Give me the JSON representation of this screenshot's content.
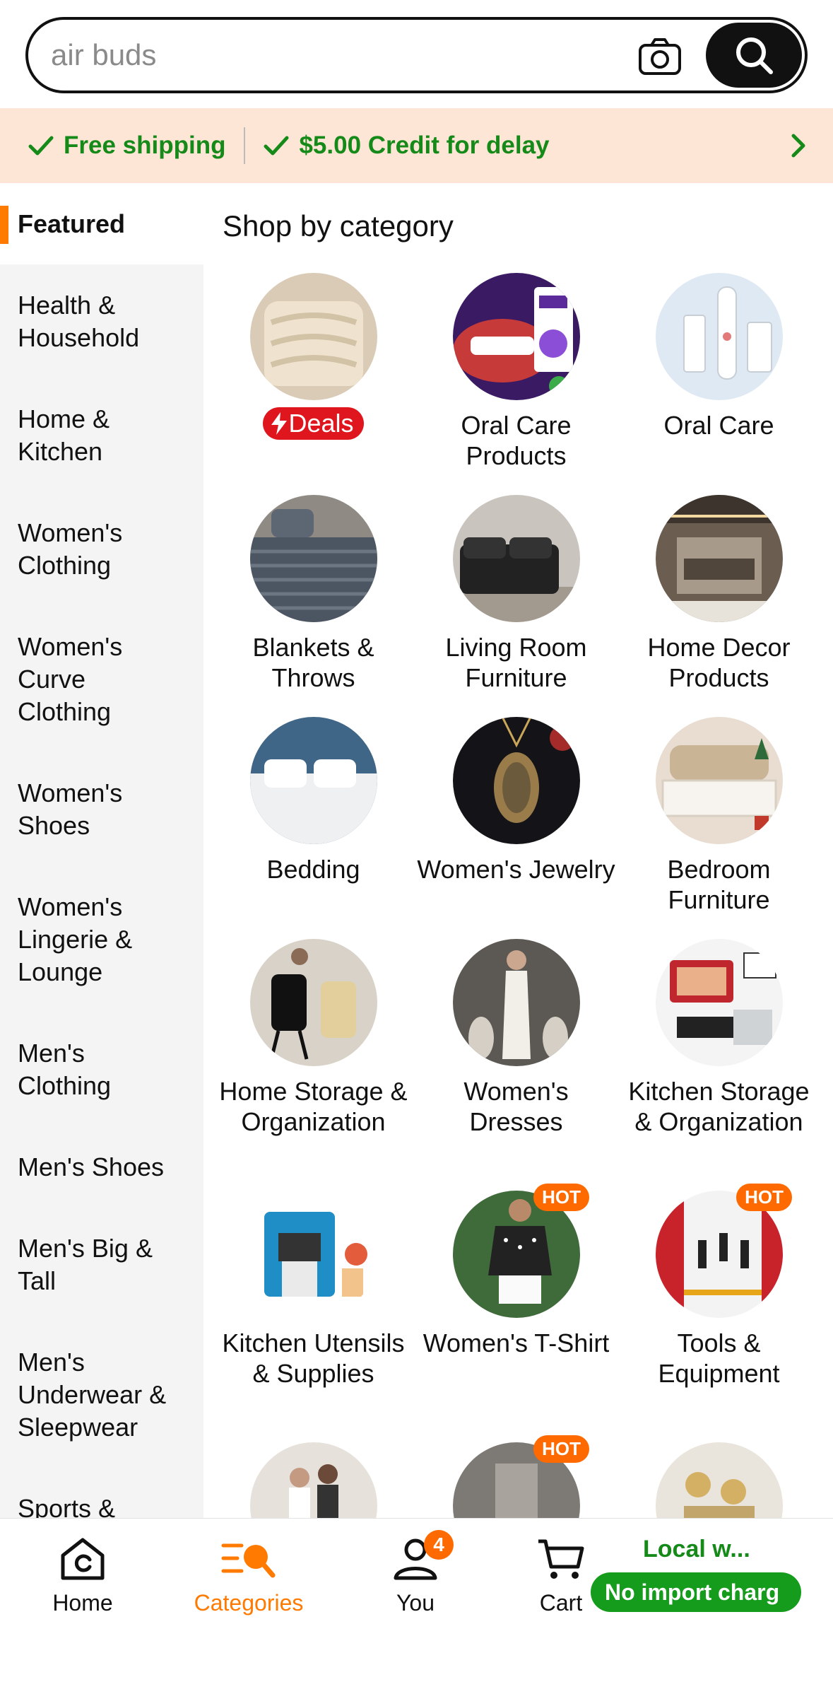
{
  "search": {
    "placeholder": "air buds"
  },
  "promo": {
    "item1": "Free shipping",
    "item2": "$5.00 Credit for delay"
  },
  "sidebar": {
    "items": [
      "Featured",
      "Health &\nHousehold",
      "Home &\nKitchen",
      "Women's\nClothing",
      "Women's\nCurve\nClothing",
      "Women's\nShoes",
      "Women's\nLingerie &\nLounge",
      "Men's\nClothing",
      "Men's Shoes",
      "Men's Big &\nTall",
      "Men's\nUnderwear &\nSleepwear",
      "Sports &"
    ]
  },
  "main": {
    "title": "Shop by category",
    "deals_label": "Deals",
    "hot_label": "HOT",
    "categories": [
      "",
      "Oral Care Products",
      "Oral Care",
      "Blankets & Throws",
      "Living Room Furniture",
      "Home Decor Products",
      "Bedding",
      "Women's Jewelry",
      "Bedroom Furniture",
      "Home Storage & Organization",
      "Women's Dresses",
      "Kitchen Storage & Organization",
      "Kitchen Utensils & Supplies",
      "Women's T-Shirt",
      "Tools & Equipment"
    ]
  },
  "nav": {
    "home": "Home",
    "categories": "Categories",
    "you": "You",
    "you_badge": "4",
    "cart": "Cart",
    "local": "Local w...",
    "import": "No import charg"
  },
  "colors": {
    "accent": "#ff7a00",
    "green": "#158a19",
    "deals": "#e0161e"
  }
}
